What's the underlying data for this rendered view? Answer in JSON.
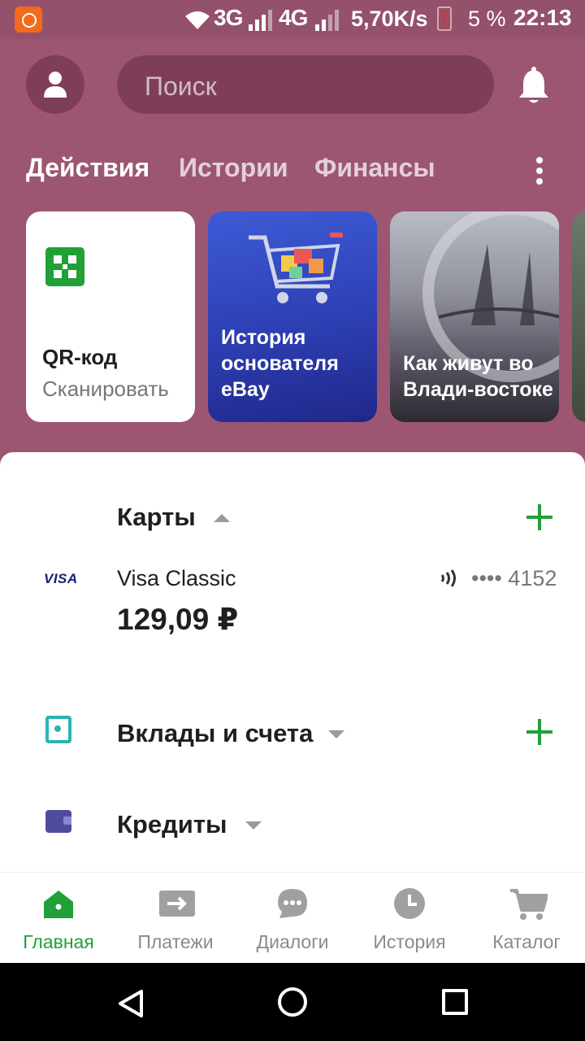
{
  "status_bar": {
    "net1": "3G",
    "net2": "4G",
    "speed": "5,70K/s",
    "battery": "5 %",
    "time": "22:13"
  },
  "header": {
    "search_placeholder": "Поиск",
    "icons": [
      "profile-icon",
      "bell-icon"
    ]
  },
  "tabs": [
    {
      "label": "Действия",
      "active": true
    },
    {
      "label": "Истории",
      "active": false
    },
    {
      "label": "Финансы",
      "active": false
    }
  ],
  "cards": {
    "qr": {
      "title": "QR-код",
      "subtitle": "Сканировать"
    },
    "stories": [
      {
        "text": "История основателя eBay"
      },
      {
        "text": "Как живут во Влади-востоке"
      }
    ]
  },
  "accounts": {
    "cards_section": {
      "title": "Карты"
    },
    "card": {
      "brand": "VISA",
      "name": "Visa Classic",
      "balance": "129,09 ₽",
      "mask": "•••• 4152"
    },
    "deposits_section": {
      "title": "Вклады и счета"
    },
    "credits_section": {
      "title": "Кредиты"
    }
  },
  "bottom_nav": [
    {
      "label": "Главная",
      "icon": "home-icon",
      "active": true
    },
    {
      "label": "Платежи",
      "icon": "transfer-icon",
      "active": false
    },
    {
      "label": "Диалоги",
      "icon": "chat-icon",
      "active": false
    },
    {
      "label": "История",
      "icon": "clock-icon",
      "active": false
    },
    {
      "label": "Каталог",
      "icon": "cart-icon",
      "active": false
    }
  ],
  "colors": {
    "brand_header": "#9c5672",
    "accent_green": "#21a038",
    "text_primary": "#1f1f1f",
    "text_secondary": "#8a8a8a"
  }
}
